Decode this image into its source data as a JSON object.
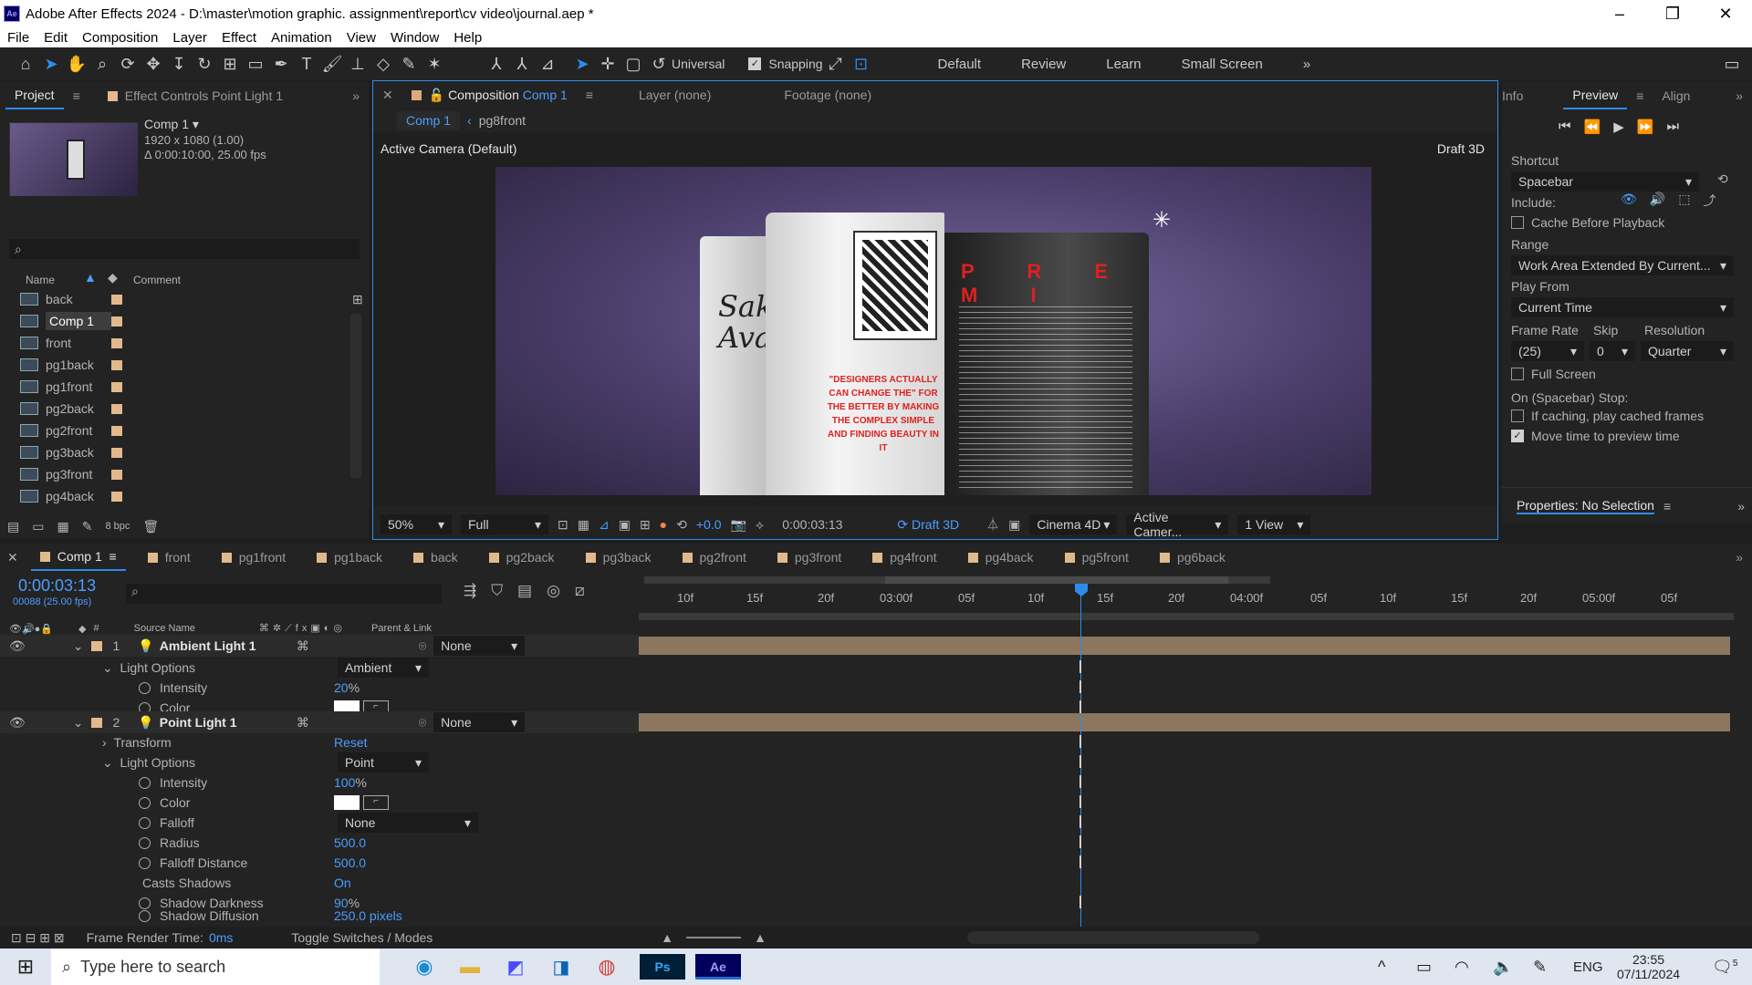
{
  "titlebar": {
    "title": "Adobe After Effects 2024 - D:\\master\\motion graphic. assignment\\report\\cv video\\journal.aep *",
    "logo": "Ae",
    "minimize": "–",
    "maximize": "❐",
    "close": "✕"
  },
  "menu": [
    "File",
    "Edit",
    "Composition",
    "Layer",
    "Effect",
    "Animation",
    "View",
    "Window",
    "Help"
  ],
  "toolbar": {
    "universal": "Universal",
    "snapping": "Snapping",
    "workspaces": [
      "Default",
      "Review",
      "Learn",
      "Small Screen"
    ]
  },
  "project": {
    "tab1": "Project",
    "tab2": "Effect Controls Point Light 1",
    "comp_name": "Comp 1",
    "comp_res": "1920 x 1080 (1.00)",
    "comp_dur": "Δ 0:00:10:00, 25.00 fps",
    "col_name": "Name",
    "col_comment": "Comment",
    "items": [
      "back",
      "Comp 1",
      "front",
      "pg1back",
      "pg1front",
      "pg2back",
      "pg2front",
      "pg3back",
      "pg3front",
      "pg4back"
    ],
    "bpc": "8 bpc"
  },
  "comp": {
    "tab": "Composition",
    "tab_comp": "Comp 1",
    "layer_tab": "Layer (none)",
    "footage_tab": "Footage (none)",
    "breadcrumb1": "Comp 1",
    "breadcrumb2": "pg8front",
    "camera": "Active Camera (Default)",
    "renderer": "Draft 3D",
    "zoom": "50%",
    "res": "Full",
    "exposure": "+0.0",
    "time": "0:00:03:13",
    "draft3d": "Draft 3D",
    "engine": "Cinema 4D",
    "view_cam": "Active Camer...",
    "views": "1 View"
  },
  "artwork": {
    "mag_title": "P R E M I",
    "quote": "\"DESIGNERS ACTUALLY CAN CHANGE THE\" FOR THE BETTER BY MAKING THE COMPLEX SIMPLE AND FINDING BEAUTY IN IT",
    "script": "Sak Ava"
  },
  "preview": {
    "tab_info": "Info",
    "tab_preview": "Preview",
    "tab_align": "Align",
    "shortcut_label": "Shortcut",
    "shortcut": "Spacebar",
    "include": "Include:",
    "cache": "Cache Before Playback",
    "range_label": "Range",
    "range": "Work Area Extended By Current...",
    "playfrom_label": "Play From",
    "playfrom": "Current Time",
    "framerate_label": "Frame Rate",
    "skip_label": "Skip",
    "resolution_label": "Resolution",
    "framerate": "(25)",
    "skip": "0",
    "resolution": "Quarter",
    "fullscreen": "Full Screen",
    "stop_label": "On (Spacebar) Stop:",
    "if_caching": "If caching, play cached frames",
    "move_time": "Move time to preview time",
    "properties": "Properties: No Selection"
  },
  "timeline": {
    "tabs": [
      "Comp 1",
      "front",
      "pg1front",
      "pg1back",
      "back",
      "pg2back",
      "pg3back",
      "pg2front",
      "pg3front",
      "pg4front",
      "pg4back",
      "pg5front",
      "pg6back"
    ],
    "timecode": "0:00:03:13",
    "frames": "00088 (25.00 fps)",
    "col_source": "Source Name",
    "col_parent": "Parent & Link",
    "ruler": [
      "10f",
      "15f",
      "20f",
      "03:00f",
      "05f",
      "10f",
      "15f",
      "20f",
      "04:00f",
      "05f",
      "10f",
      "15f",
      "20f",
      "05:00f",
      "05f"
    ],
    "layers": [
      {
        "num": "1",
        "name": "Ambient Light 1",
        "parent": "None"
      },
      {
        "num": "2",
        "name": "Point Light 1",
        "parent": "None"
      }
    ],
    "props": {
      "light_options": "Light Options",
      "ambient": "Ambient",
      "intensity": "Intensity",
      "intensity1": "20",
      "color": "Color",
      "transform": "Transform",
      "reset": "Reset",
      "point": "Point",
      "intensity2": "100",
      "falloff": "Falloff",
      "falloff_val": "None",
      "radius": "Radius",
      "radius_val": "500.0",
      "falloff_dist": "Falloff Distance",
      "falloff_dist_val": "500.0",
      "casts": "Casts Shadows",
      "casts_val": "On",
      "shadow_dark": "Shadow Darkness",
      "shadow_dark_val": "90",
      "shadow_diff": "Shadow Diffusion",
      "shadow_diff_val": "250.0 pixels",
      "pct": "%"
    },
    "render_time_label": "Frame Render Time:",
    "render_time": "0ms",
    "toggle": "Toggle Switches / Modes"
  },
  "taskbar": {
    "search": "Type here to search",
    "lang": "ENG",
    "time": "23:55",
    "date": "07/11/2024",
    "notif": "5"
  },
  "colors": {
    "accent": "#2d8ceb",
    "label": "#e2b98c",
    "track": "#8c7660"
  }
}
